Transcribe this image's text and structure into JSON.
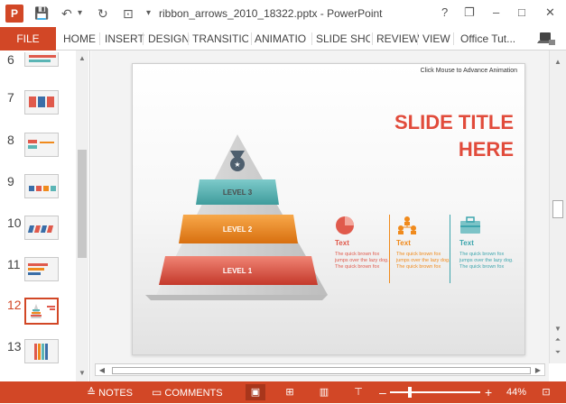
{
  "titlebar": {
    "app_icon": "P",
    "title": "ribbon_arrows_2010_18322.pptx - PowerPoint",
    "help": "?",
    "restore": "❐",
    "minimize": "–",
    "maximize": "□",
    "close": "✕",
    "qat_save": "💾",
    "qat_undo": "↶",
    "qat_undo_more": "▾",
    "qat_redo": "↻",
    "qat_present": "⊡",
    "qat_more": "▾"
  },
  "ribbon": {
    "file": "FILE",
    "tabs": [
      "HOME",
      "INSERT",
      "DESIGN",
      "TRANSITIO",
      "ANIMATIO",
      "SLIDE SHO",
      "REVIEW",
      "VIEW"
    ],
    "account": "Office Tut...",
    "account_icon": "laptop-icon"
  },
  "thumbnails": {
    "numbers": [
      "6",
      "7",
      "8",
      "9",
      "10",
      "11",
      "12",
      "13"
    ],
    "active": "12"
  },
  "slide": {
    "hint": "Click Mouse to Advance Animation",
    "title_line1": "SLIDE TITLE",
    "title_line2": "HERE",
    "levels": [
      "LEVEL 3",
      "LEVEL 2",
      "LEVEL 1"
    ],
    "columns": [
      {
        "head": "Text",
        "body": "The quick brown fox jumps over the lazy dog. The quick brown fox",
        "color": "#e05a4c"
      },
      {
        "head": "Text",
        "body": "The quick brown fox jumps over the lazy dog. The quick brown fox",
        "color": "#f08a1c"
      },
      {
        "head": "Text",
        "body": "The quick brown fox jumps over the lazy dog. The quick brown fox",
        "color": "#3da5ad"
      }
    ]
  },
  "statusbar": {
    "notes": "NOTES",
    "comments": "COMMENTS",
    "zoom_minus": "–",
    "zoom_plus": "+",
    "zoom": "44%"
  },
  "colors": {
    "accent": "#d24726",
    "level3": "#5bb5b5",
    "level2": "#f08a1c",
    "level1": "#e05a4c"
  }
}
